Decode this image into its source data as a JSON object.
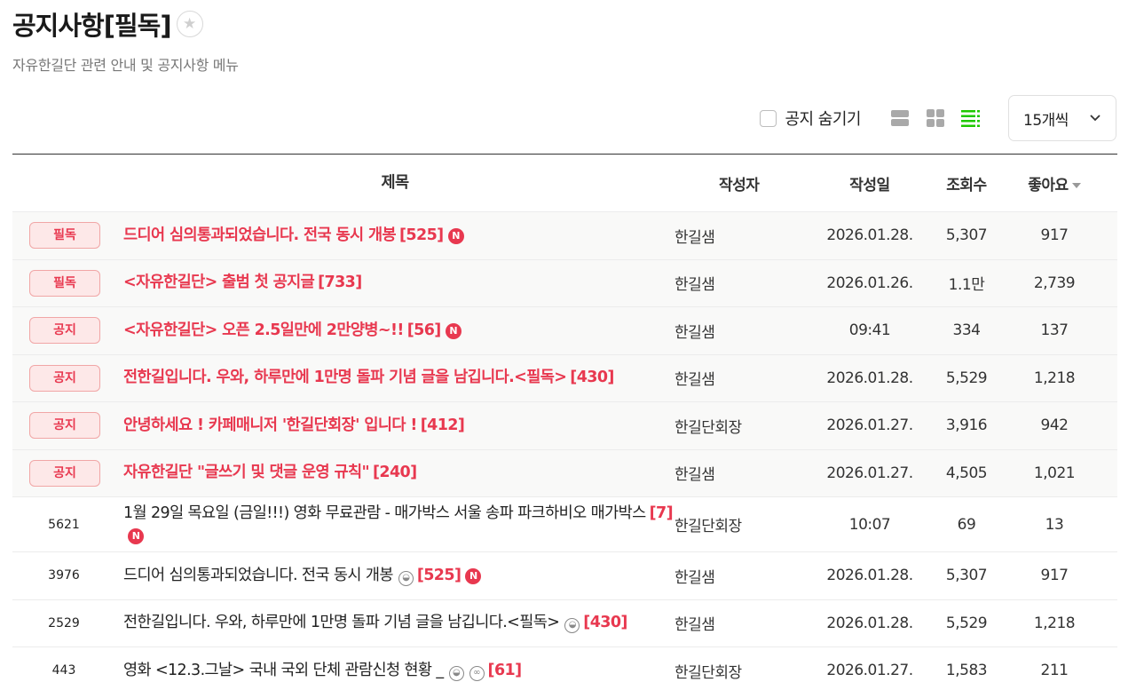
{
  "header": {
    "title": "공지사항[필독]",
    "subtitle": "자유한길단 관련 안내 및 공지사항 메뉴"
  },
  "toolbar": {
    "hide_notice_label": "공지 숨기기",
    "hide_notice_checked": false,
    "view_modes": [
      "card-view",
      "album-view",
      "list-view"
    ],
    "active_view": "list-view",
    "per_page": "15개씩",
    "accent_color": "#1ec800"
  },
  "table": {
    "headers": {
      "title": "제목",
      "author": "작성자",
      "date": "작성일",
      "views": "조회수",
      "likes": "좋아요"
    },
    "notice_rows": [
      {
        "badge": "필독",
        "title": "드디어 심의통과되었습니다. 전국 동시 개봉",
        "comments": "[525]",
        "new": true,
        "author": "한길샘",
        "date": "2026.01.28.",
        "views": "5,307",
        "likes": "917"
      },
      {
        "badge": "필독",
        "title": "<자유한길단> 출범 첫 공지글",
        "comments": "[733]",
        "new": false,
        "author": "한길샘",
        "date": "2026.01.26.",
        "views": "1.1만",
        "likes": "2,739"
      },
      {
        "badge": "공지",
        "title": "<자유한길단> 오픈 2.5일만에 2만양병~!!",
        "comments": "[56]",
        "new": true,
        "author": "한길샘",
        "date": "09:41",
        "views": "334",
        "likes": "137"
      },
      {
        "badge": "공지",
        "title": "전한길입니다. 우와, 하루만에 1만명 돌파 기념 글을 남깁니다.<필독>",
        "comments": "[430]",
        "new": false,
        "author": "한길샘",
        "date": "2026.01.28.",
        "views": "5,529",
        "likes": "1,218"
      },
      {
        "badge": "공지",
        "title": "안녕하세요 ! 카페매니저 '한길단회장' 입니다 !",
        "comments": "[412]",
        "new": false,
        "author": "한길단회장",
        "date": "2026.01.27.",
        "views": "3,916",
        "likes": "942"
      },
      {
        "badge": "공지",
        "title": "자유한길단 \"글쓰기 및 댓글 운영 규칙\"",
        "comments": "[240]",
        "new": false,
        "author": "한길샘",
        "date": "2026.01.27.",
        "views": "4,505",
        "likes": "1,021"
      }
    ],
    "post_rows": [
      {
        "num": "5621",
        "title": "1월 29일 목요일 (금일!!!) 영화 무료관람 - 매가박스 서울 송파 파크하비오 매가박스",
        "comments": "[7]",
        "new": true,
        "image": false,
        "link": false,
        "author": "한길단회장",
        "date": "10:07",
        "views": "69",
        "likes": "13"
      },
      {
        "num": "3976",
        "title": "드디어 심의통과되었습니다. 전국 동시 개봉",
        "comments": "[525]",
        "new": true,
        "image": true,
        "link": false,
        "author": "한길샘",
        "date": "2026.01.28.",
        "views": "5,307",
        "likes": "917"
      },
      {
        "num": "2529",
        "title": "전한길입니다. 우와, 하루만에 1만명 돌파 기념 글을 남깁니다.<필독>",
        "comments": "[430]",
        "new": false,
        "image": true,
        "link": false,
        "author": "한길샘",
        "date": "2026.01.28.",
        "views": "5,529",
        "likes": "1,218"
      },
      {
        "num": "443",
        "title": "영화 <12.3.그날> 국내 국외 단체 관람신청 현황 _",
        "comments": "[61]",
        "new": false,
        "image": true,
        "link": true,
        "author": "한길단회장",
        "date": "2026.01.27.",
        "views": "1,583",
        "likes": "211"
      }
    ],
    "new_icon_text": "N",
    "image_icon_text": "◒",
    "link_icon_text": "∞"
  }
}
